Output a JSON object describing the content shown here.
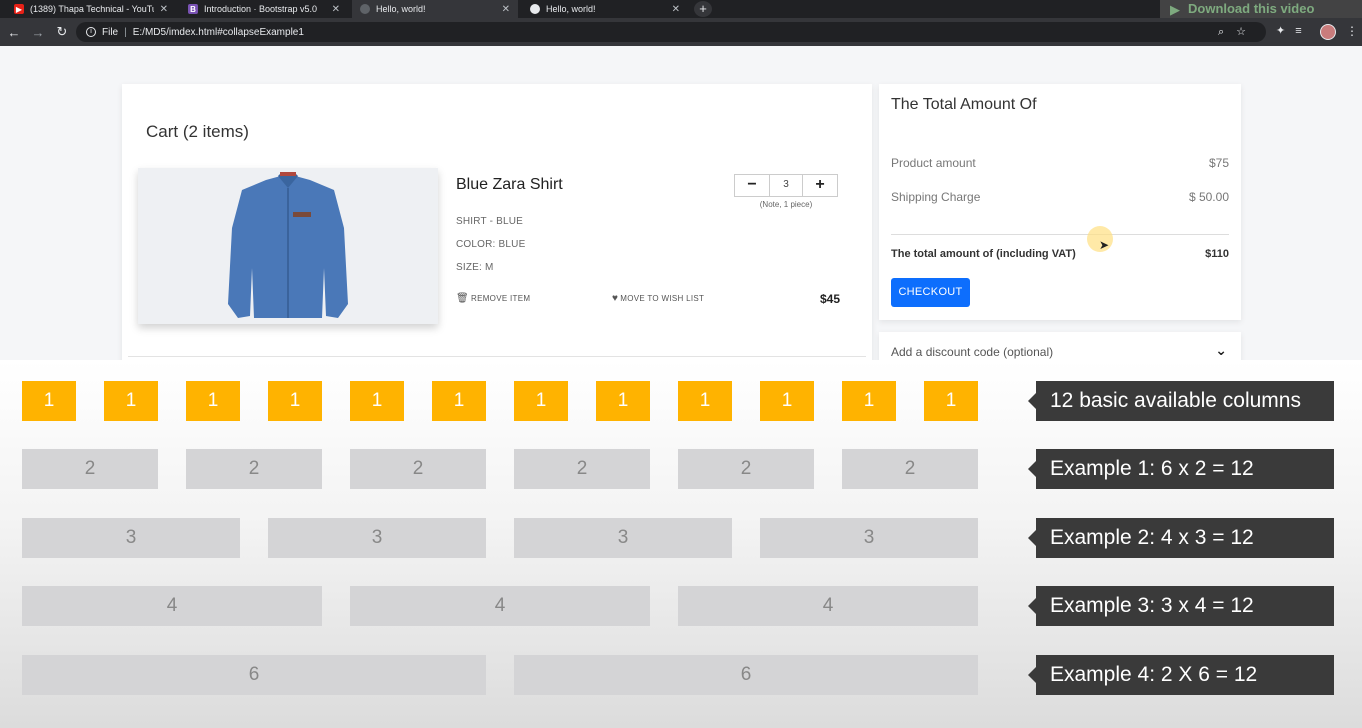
{
  "browser": {
    "tabs": [
      {
        "title": "(1389) Thapa Technical - YouTube",
        "icon": "youtube-icon",
        "active": false
      },
      {
        "title": "Introduction · Bootstrap v5.0",
        "icon": "bootstrap-icon",
        "active": false
      },
      {
        "title": "Hello, world!",
        "icon": "globe-icon",
        "active": true
      },
      {
        "title": "Hello, world!",
        "icon": "globe-icon",
        "active": false
      }
    ],
    "url_scheme": "File",
    "url": "E:/MD5/imdex.html#collapseExample1",
    "overlay_text": "Download this video"
  },
  "cart": {
    "title": "Cart (2 items)",
    "product": {
      "name": "Blue Zara Shirt",
      "attributes": [
        "SHIRT - BLUE",
        "COLOR: BLUE",
        "SIZE: M"
      ],
      "quantity": "3",
      "qty_note": "(Note, 1 piece)",
      "remove_label": "REMOVE ITEM",
      "wishlist_label": "MOVE TO WISH LIST",
      "price": "$45"
    }
  },
  "summary": {
    "title": "The Total Amount Of",
    "product_amount_label": "Product amount",
    "product_amount_value": "$75",
    "shipping_label": "Shipping Charge",
    "shipping_value": "$ 50.00",
    "total_label": "The total amount of (including VAT)",
    "total_value": "$110",
    "checkout_label": "CHECKOUT",
    "discount_label": "Add a discount code (optional)"
  },
  "grid_slide": {
    "colors": {
      "accent": "#ffb300",
      "grey": "#d4d4d6",
      "callout": "#3a3a3a"
    },
    "rows": [
      {
        "cells": [
          "1",
          "1",
          "1",
          "1",
          "1",
          "1",
          "1",
          "1",
          "1",
          "1",
          "1",
          "1"
        ],
        "caption": "12 basic available columns"
      },
      {
        "cells": [
          "2",
          "2",
          "2",
          "2",
          "2",
          "2"
        ],
        "caption": "Example 1:  6 x 2 = 12"
      },
      {
        "cells": [
          "3",
          "3",
          "3",
          "3"
        ],
        "caption": "Example 2:  4 x 3 = 12"
      },
      {
        "cells": [
          "4",
          "4",
          "4"
        ],
        "caption": "Example 3:  3 x 4 = 12"
      },
      {
        "cells": [
          "6",
          "6"
        ],
        "caption": "Example 4:  2 X 6 = 12"
      }
    ]
  }
}
